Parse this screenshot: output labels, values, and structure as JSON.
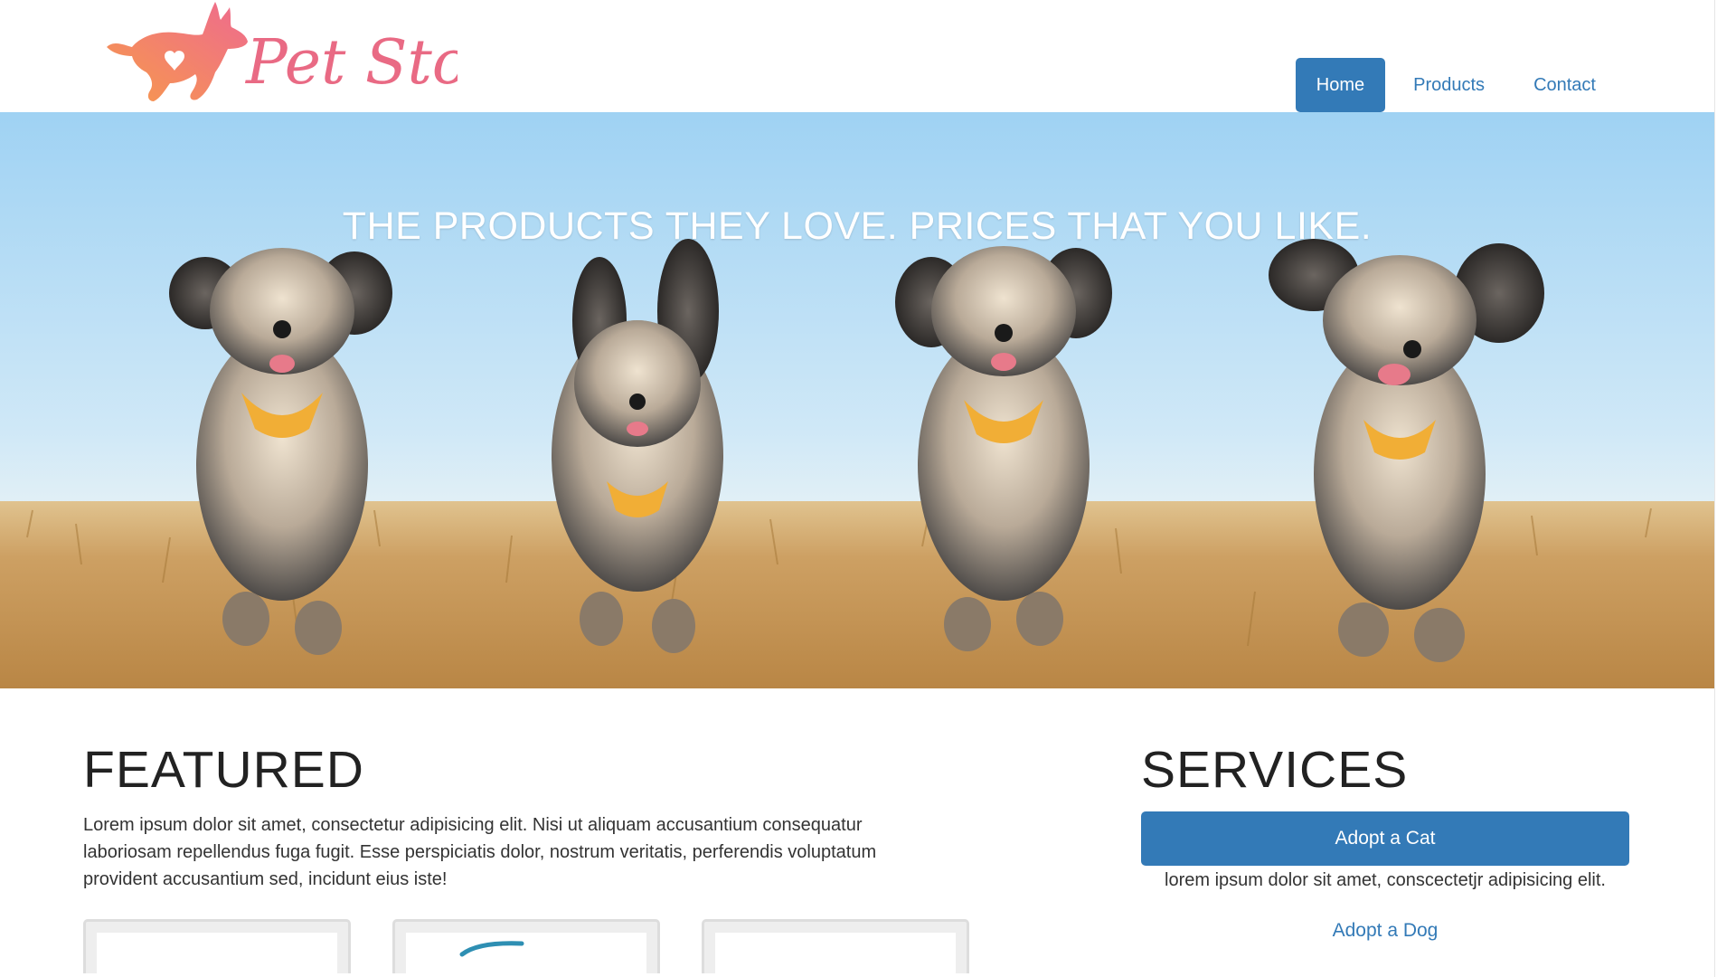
{
  "brand": {
    "name": "Pet Store",
    "logo_icon": "dog-heart-logo-icon",
    "logo_color": "#f0747e"
  },
  "nav": {
    "items": [
      {
        "label": "Home",
        "active": true
      },
      {
        "label": "Products",
        "active": false
      },
      {
        "label": "Contact",
        "active": false
      }
    ],
    "accent": "#337ab7"
  },
  "hero": {
    "tagline": "THE PRODUCTS THEY LOVE. PRICES THAT YOU LIKE.",
    "image": "four-running-dogs-in-field"
  },
  "featured": {
    "title": "FEATURED",
    "text": "Lorem ipsum dolor sit amet, consectetur adipisicing elit. Nisi ut aliquam accusantium consequatur laboriosam repellendus fuga fugit. Esse perspiciatis dolor, nostrum veritatis, perferendis voluptatum provident accusantium sed, incidunt eius iste!"
  },
  "services": {
    "title": "SERVICES",
    "primary_button": "Adopt a Cat",
    "description": "lorem ipsum dolor sit amet, conscectetjr adipisicing elit.",
    "secondary_link": "Adopt a Dog"
  }
}
